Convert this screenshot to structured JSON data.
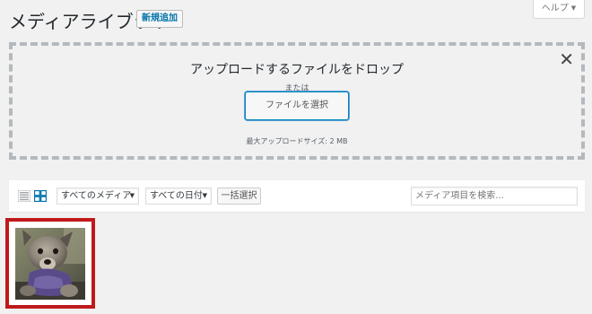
{
  "header": {
    "title": "メディアライブラリ",
    "add_new_label": "新規追加",
    "help_label": "ヘルプ"
  },
  "uploader": {
    "drop_instructions": "アップロードするファイルをドロップ",
    "or_label": "または",
    "select_files_label": "ファイルを選択",
    "max_size_label": "最大アップロードサイズ: 2 MB",
    "close_glyph": "✕"
  },
  "toolbar": {
    "media_type_filter": "すべてのメディア",
    "date_filter": "すべての日付",
    "bulk_select_label": "一括選択",
    "search_placeholder": "メディア項目を検索..."
  },
  "icons": {
    "list_view": "list-view-icon",
    "grid_view": "grid-view-icon"
  },
  "colors": {
    "accent": "#0073aa",
    "selected_outline": "#c0191b",
    "background": "#f1f1f1"
  }
}
